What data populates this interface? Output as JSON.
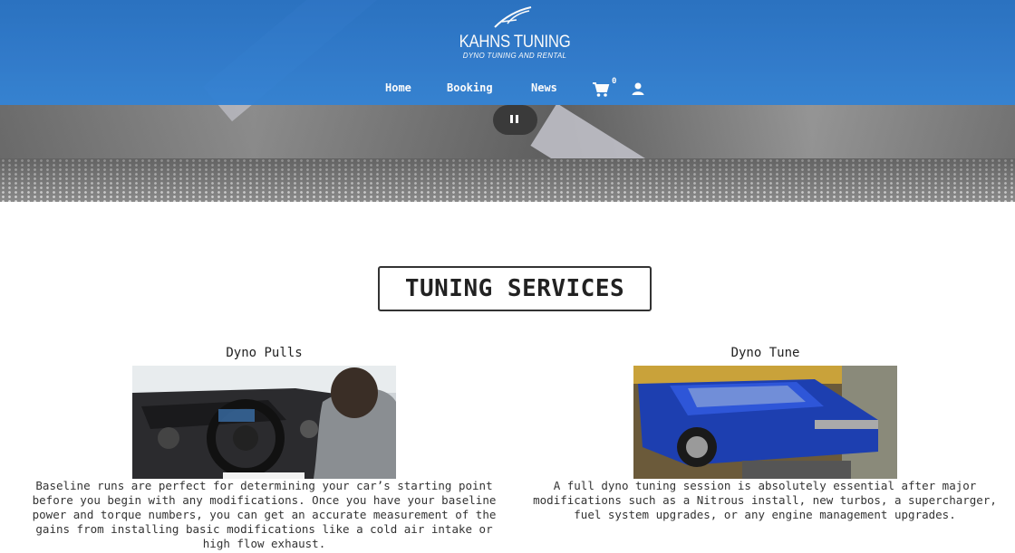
{
  "brand": {
    "name": "KAHNS TUNING",
    "tagline": "DYNO TUNING AND RENTAL"
  },
  "nav": {
    "home": "Home",
    "booking": "Booking",
    "news": "News",
    "cart_count": "0"
  },
  "colors": {
    "header_blue": "#2f79c9",
    "text": "#333333"
  },
  "section": {
    "title": "TUNING SERVICES"
  },
  "services": [
    {
      "name": "Dyno Pulls",
      "description": "Baseline runs are perfect for determining your car’s starting point before you begin with any modifications. Once you have your baseline power and torque numbers, you can get an accurate measurement of the gains from installing basic modifications like a cold air intake or high flow exhaust."
    },
    {
      "name": "Dyno Tune",
      "description": "A full dyno tuning session is absolutely essential after major modifications such as a Nitrous install, new turbos, a supercharger, fuel system upgrades, or any engine management upgrades."
    }
  ]
}
